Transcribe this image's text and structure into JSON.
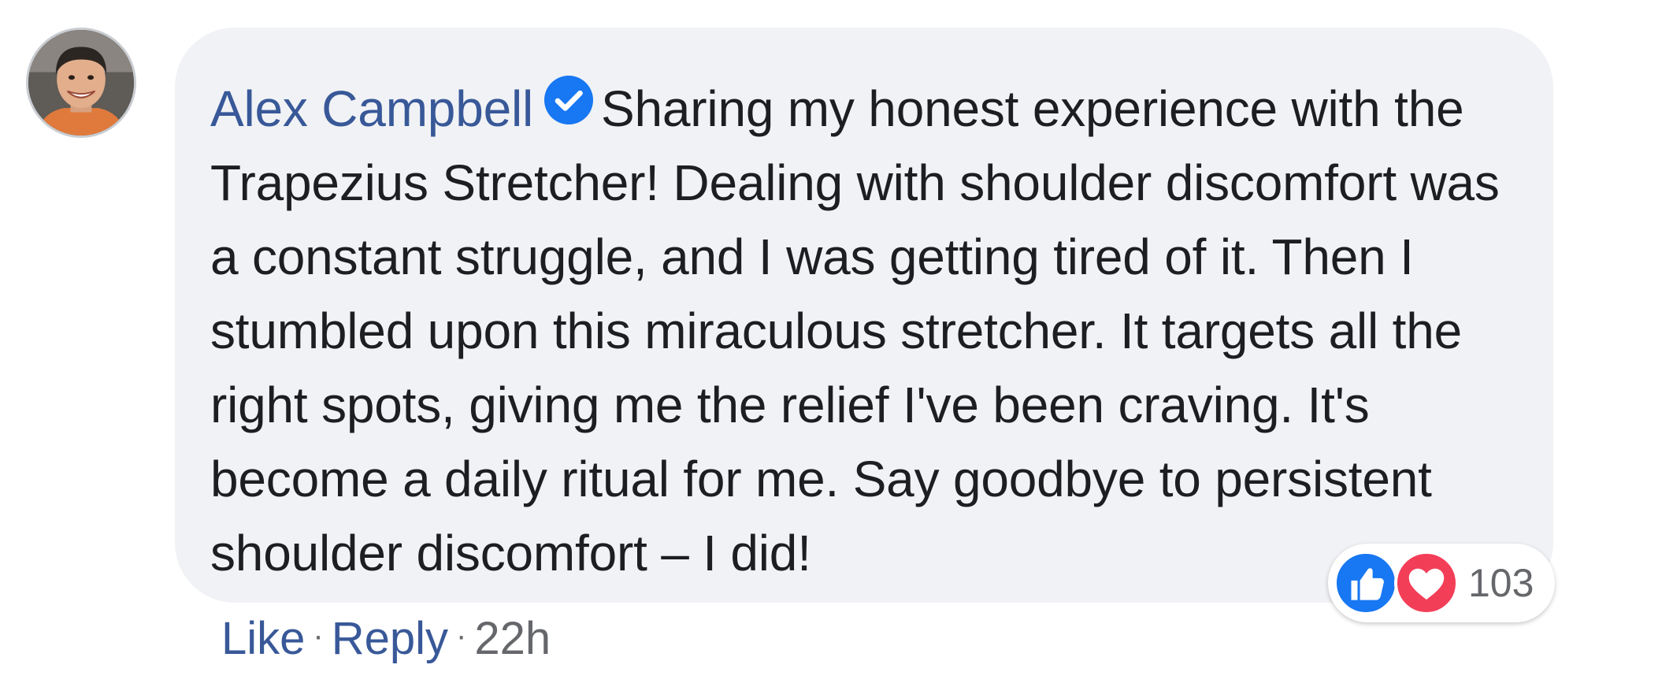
{
  "comment": {
    "author": "Alex Campbell",
    "verified": true,
    "text": "Sharing my honest experience with the Trapezius Stretcher! Dealing with shoulder discomfort was a constant struggle, and I was getting tired of it. Then I stumbled upon this miraculous stretcher. It targets all the right spots, giving me the relief I've been craving. It's become a daily ritual for me. Say goodbye to persistent shoulder discomfort – I did!",
    "reactions": {
      "types": [
        "like-icon",
        "love-icon"
      ],
      "count": "103"
    },
    "actions": {
      "like_label": "Like",
      "reply_label": "Reply",
      "timestamp": "22h"
    }
  },
  "colors": {
    "author_link": "#385898",
    "bubble_bg": "#f0f2f5",
    "text": "#1c1e21",
    "meta": "#65676b",
    "like_blue": "#1877f2",
    "love_red": "#f33e58"
  }
}
